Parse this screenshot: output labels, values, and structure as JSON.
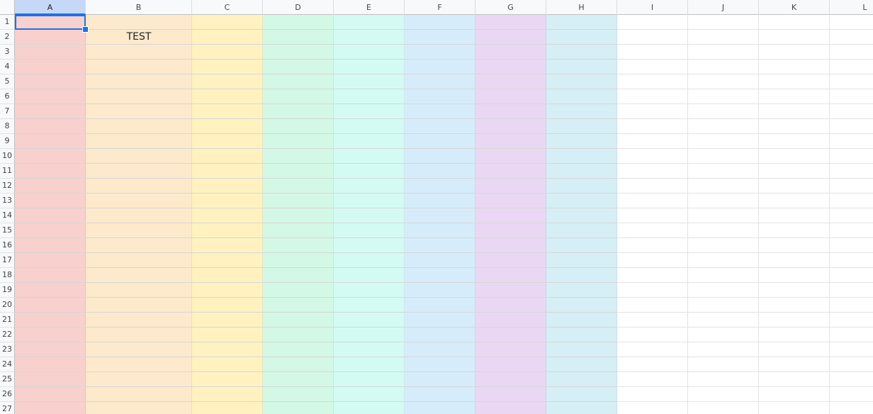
{
  "columns": [
    {
      "label": "A",
      "fill": "#f8d0cd"
    },
    {
      "label": "B",
      "fill": "#fde9cb"
    },
    {
      "label": "C",
      "fill": "#fff2c0"
    },
    {
      "label": "D",
      "fill": "#d4f8e6"
    },
    {
      "label": "E",
      "fill": "#d3fbf4"
    },
    {
      "label": "F",
      "fill": "#d6ecfb"
    },
    {
      "label": "G",
      "fill": "#ead7f3"
    },
    {
      "label": "H",
      "fill": "#d6eef6"
    },
    {
      "label": "I",
      "fill": ""
    },
    {
      "label": "J",
      "fill": ""
    },
    {
      "label": "K",
      "fill": ""
    },
    {
      "label": "L",
      "fill": ""
    }
  ],
  "rows": [
    "1",
    "2",
    "3",
    "4",
    "5",
    "6",
    "7",
    "8",
    "9",
    "10",
    "11",
    "12",
    "13",
    "14",
    "15",
    "16",
    "17",
    "18",
    "19",
    "20",
    "21",
    "22",
    "23",
    "24",
    "25",
    "26",
    "27"
  ],
  "cells": [
    {
      "col": "B",
      "row": "2",
      "value": "TEST"
    }
  ],
  "selected_cell": {
    "col": "A",
    "row": "1"
  },
  "colors": {
    "selection": "#1a73e8",
    "header_selected": "#c6d8f7"
  }
}
